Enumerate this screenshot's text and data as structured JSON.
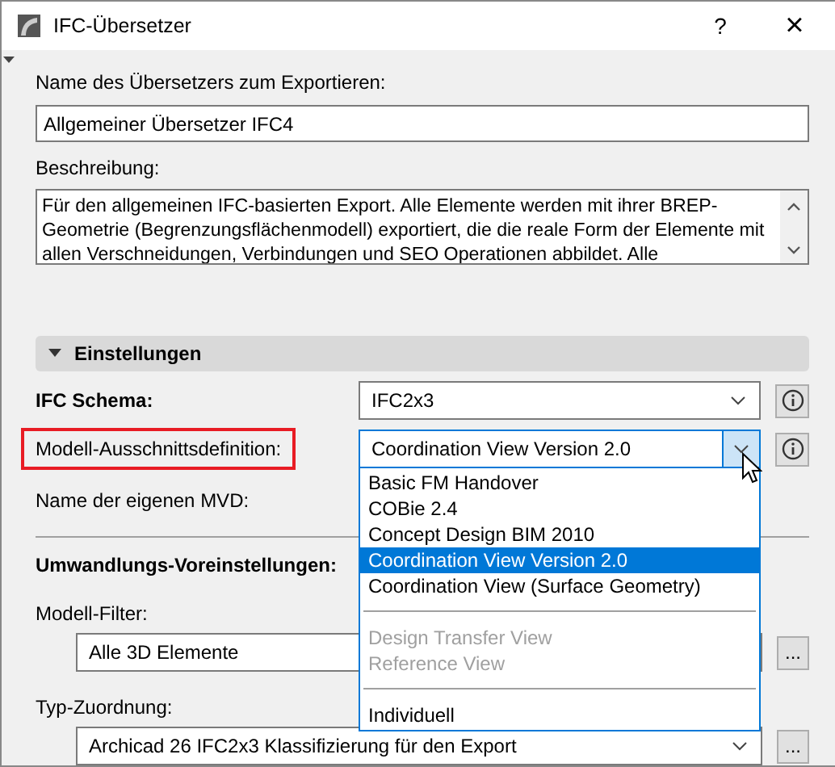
{
  "window": {
    "title": "IFC-Übersetzer",
    "help": "?",
    "close": "×"
  },
  "name_label": "Name des Übersetzers zum Exportieren:",
  "name_field": {
    "value": "Allgemeiner Übersetzer IFC4"
  },
  "description_label": "Beschreibung:",
  "description": [
    "Für den allgemeinen IFC-basierten Export. Alle Elemente werden mit ihrer BREP-",
    "Geometrie (Begrenzungsflächenmodell) exportiert, die die reale Form der Elemente mit",
    "allen Verschneidungen, Verbindungen und SEO Operationen abbildet. Alle"
  ],
  "section": {
    "title": "Einstellungen",
    "expanded": true
  },
  "ifc_schema": {
    "label": "IFC Schema:",
    "value": "IFC2x3"
  },
  "mvd": {
    "label": "Modell-Ausschnittsdefinition:",
    "value": "Coordination View Version 2.0",
    "highlighted": true,
    "open": true,
    "options": [
      {
        "kind": "item",
        "label": "Basic FM Handover",
        "selected": false,
        "disabled": false
      },
      {
        "kind": "item",
        "label": "COBie 2.4",
        "selected": false,
        "disabled": false
      },
      {
        "kind": "item",
        "label": "Concept Design BIM 2010",
        "selected": false,
        "disabled": false
      },
      {
        "kind": "item",
        "label": "Coordination View Version 2.0",
        "selected": true,
        "disabled": false
      },
      {
        "kind": "item",
        "label": "Coordination View (Surface Geometry)",
        "selected": false,
        "disabled": false
      },
      {
        "kind": "separator"
      },
      {
        "kind": "item",
        "label": "Design Transfer View",
        "selected": false,
        "disabled": true
      },
      {
        "kind": "item",
        "label": "Reference View",
        "selected": false,
        "disabled": true
      },
      {
        "kind": "separator"
      },
      {
        "kind": "item",
        "label": "Individuell",
        "selected": false,
        "disabled": false
      }
    ]
  },
  "custom_mvd_label": "Name der eigenen MVD:",
  "conversion_label": "Umwandlungs-Voreinstellungen:",
  "model_filter": {
    "label": "Modell-Filter:",
    "value": "Alle 3D Elemente",
    "more": "..."
  },
  "type_mapping": {
    "label": "Typ-Zuordnung:",
    "value": "Archicad 26 IFC2x3 Klassifizierung für den Export",
    "more": "..."
  }
}
